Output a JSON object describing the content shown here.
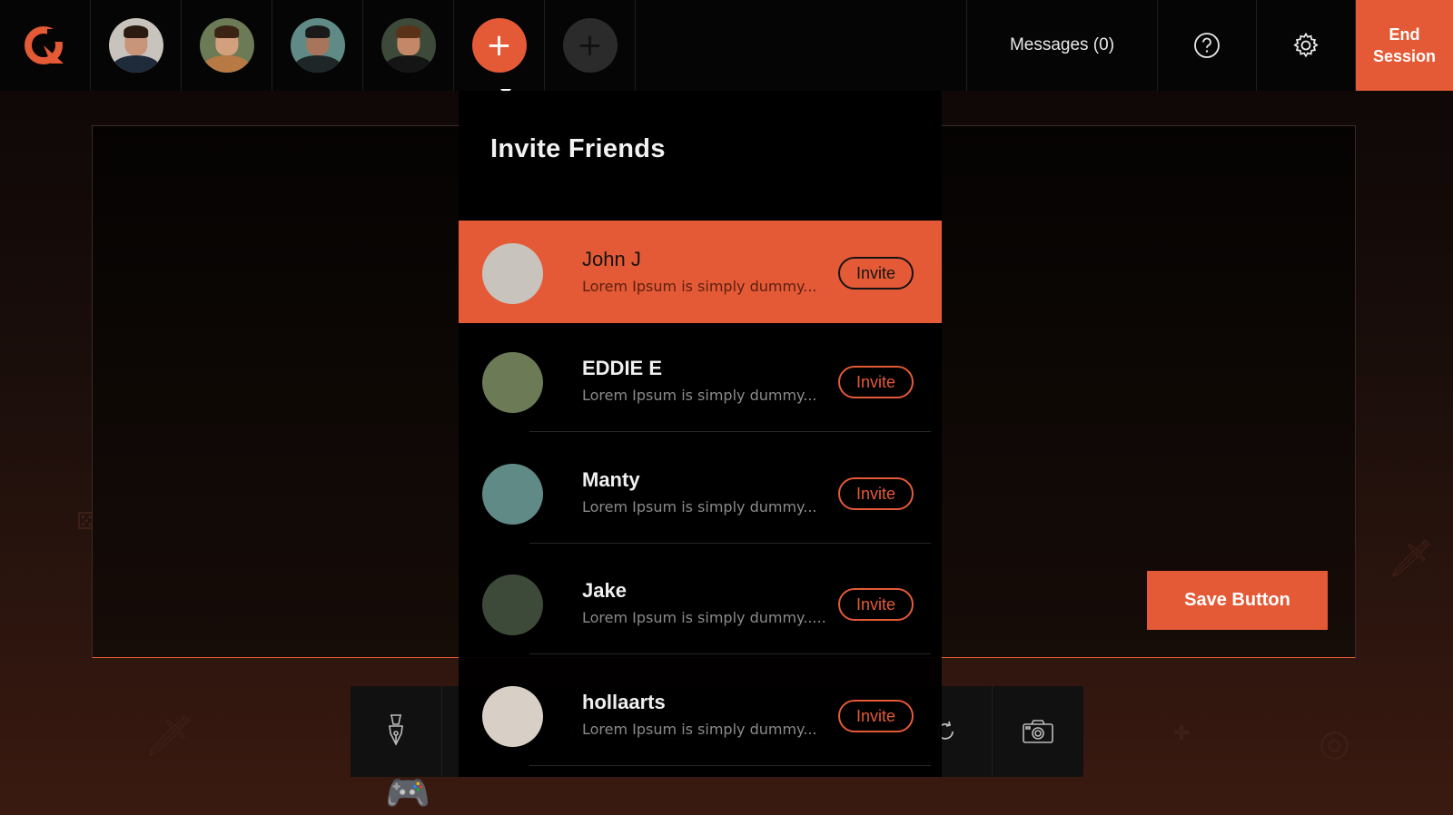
{
  "colors": {
    "accent": "#e55a36",
    "bar": "#050505",
    "text": "#ffffff"
  },
  "header": {
    "logo_icon": "logo-icon",
    "participants": [
      {
        "name": "participant-1",
        "skin": "#c9957a",
        "hair": "#2a1a10",
        "shirt": "#1f2a3a",
        "bg": "#c9c3bd"
      },
      {
        "name": "participant-2",
        "skin": "#d3a07d",
        "hair": "#3b2413",
        "shirt": "#b77a45",
        "bg": "#6c7a56"
      },
      {
        "name": "participant-3",
        "skin": "#a6755c",
        "hair": "#1a1a1a",
        "shirt": "#1e2628",
        "bg": "#5f8a86"
      },
      {
        "name": "participant-4",
        "skin": "#c48767",
        "hair": "#5a3218",
        "shirt": "#151515",
        "bg": "#3d4a3a"
      }
    ],
    "add_active_icon": "+",
    "add_idle_icon": "+",
    "messages_label": "Messages (0)",
    "help_icon": "help-icon",
    "settings_icon": "gear-icon",
    "end_session_label": "End\nSession"
  },
  "invite": {
    "title": "Invite Friends",
    "friends": [
      {
        "name": "John J",
        "subtitle": "Lorem Ipsum is simply dummy...",
        "button": "Invite",
        "active": true,
        "skin": "#c9957a",
        "hair": "#2a1a10",
        "shirt": "#1f2a3a",
        "bg": "#c9c3bd"
      },
      {
        "name": "EDDIE E",
        "subtitle": "Lorem Ipsum is simply dummy...",
        "button": "Invite",
        "active": false,
        "skin": "#d3a07d",
        "hair": "#3b2413",
        "shirt": "#b77a45",
        "bg": "#6c7a56"
      },
      {
        "name": "Manty",
        "subtitle": "Lorem Ipsum is simply dummy...",
        "button": "Invite",
        "active": false,
        "skin": "#a6755c",
        "hair": "#1a1a1a",
        "shirt": "#1e2628",
        "bg": "#5f8a86"
      },
      {
        "name": "Jake",
        "subtitle": "Lorem Ipsum is simply dummy.....",
        "button": "Invite",
        "active": false,
        "skin": "#c48767",
        "hair": "#5a3218",
        "shirt": "#151515",
        "bg": "#3d4a3a"
      },
      {
        "name": "hollaarts",
        "subtitle": "Lorem Ipsum is simply dummy...",
        "button": "Invite",
        "active": false,
        "skin": "#e3b49a",
        "hair": "#6a3a22",
        "shirt": "#7a2a30",
        "bg": "#d8cfc7"
      }
    ]
  },
  "canvas": {
    "save_label": "Save Button"
  },
  "toolbar": {
    "tools": [
      "pen-icon",
      "brush-icon",
      "eraser-icon",
      "shape-icon",
      "undo-icon",
      "circle-icon",
      "redo-icon",
      "camera-icon"
    ]
  }
}
